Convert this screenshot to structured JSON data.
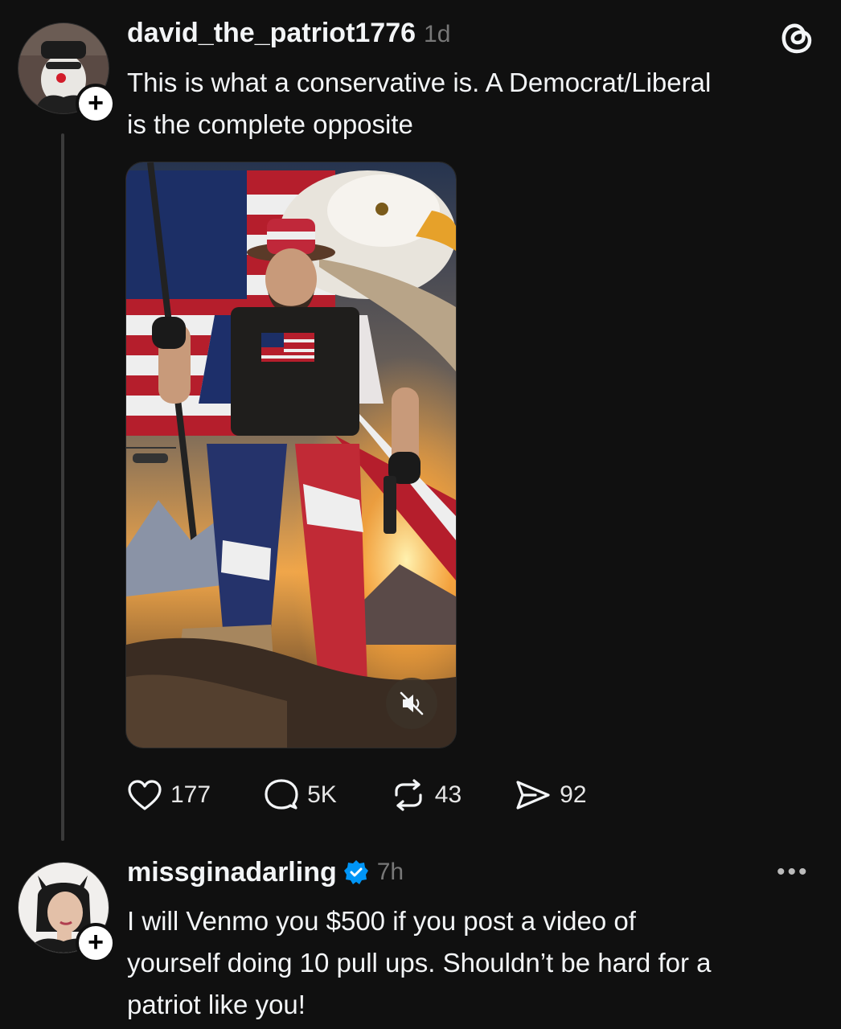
{
  "post": {
    "username": "david_the_patriot1776",
    "time": "1d",
    "text_line1": "This is what a conservative is. A Democrat/Liberal",
    "text_line2": "is the complete opposite",
    "actions": {
      "likes": "177",
      "replies": "5K",
      "reposts": "43",
      "shares": "92"
    }
  },
  "reply": {
    "username": "missginadarling",
    "time": "7h",
    "verified": true,
    "text_line1": "I will Venmo you $500 if you post a video of",
    "text_line2": "yourself doing 10 pull ups. Shouldn’t be hard for a",
    "text_line3": "patriot like you!"
  },
  "icons": {
    "app": "threads-logo-icon",
    "follow": "plus-icon",
    "like": "heart-icon",
    "reply": "comment-icon",
    "repost": "repost-icon",
    "share": "send-icon",
    "mute": "speaker-muted-icon",
    "verified": "verified-badge-icon",
    "more": "more-icon"
  },
  "colors": {
    "background": "#101010",
    "text": "#f3f5f7",
    "muted": "#777777",
    "verified": "#0095f6"
  }
}
